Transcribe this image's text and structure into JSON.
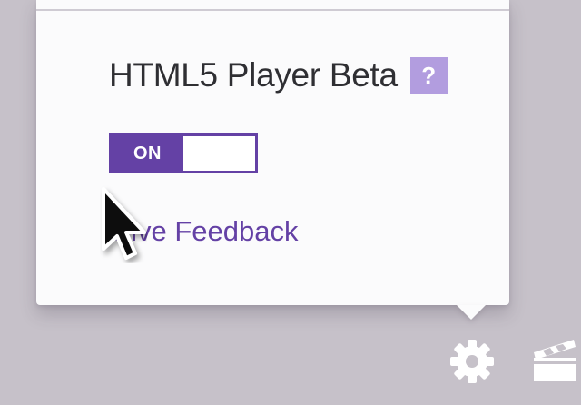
{
  "popup": {
    "title": "HTML5 Player Beta",
    "help_label": "?",
    "toggle": {
      "state_label": "ON",
      "is_on": true
    },
    "feedback_link": "Give Feedback"
  },
  "bottom_bar": {
    "settings_icon": "gear-icon",
    "theatre_icon": "clapperboard-icon"
  },
  "colors": {
    "accent": "#6441a5",
    "help_badge": "#b29ddf",
    "background": "#c6c1c9",
    "popup": "#fbfbfc"
  }
}
